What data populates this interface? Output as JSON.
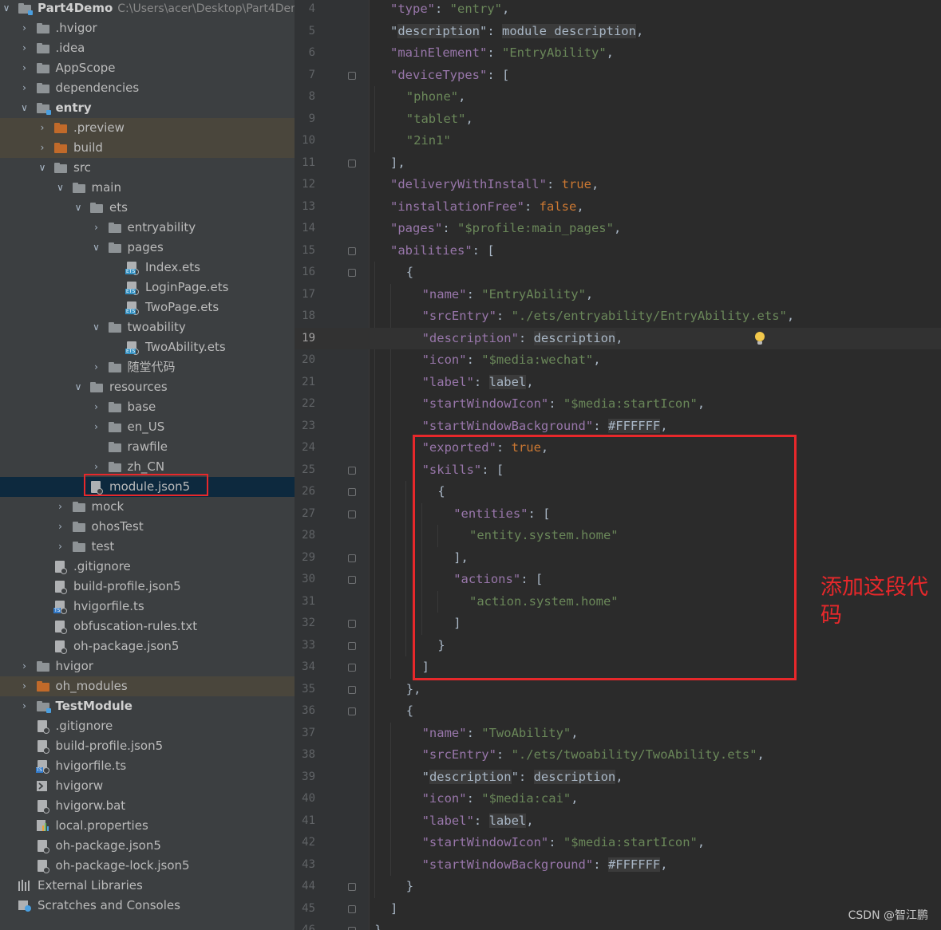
{
  "project_tree": [
    {
      "label": "Part4Demo",
      "path": "C:\\Users\\acer\\Desktop\\Part4Der",
      "level": 0,
      "arrow": "open",
      "icon": "module-folder",
      "bold": true
    },
    {
      "label": ".hvigor",
      "level": 1,
      "arrow": "closed",
      "icon": "folder"
    },
    {
      "label": ".idea",
      "level": 1,
      "arrow": "closed",
      "icon": "folder"
    },
    {
      "label": "AppScope",
      "level": 1,
      "arrow": "closed",
      "icon": "folder"
    },
    {
      "label": "dependencies",
      "level": 1,
      "arrow": "closed",
      "icon": "folder"
    },
    {
      "label": "entry",
      "level": 1,
      "arrow": "open",
      "icon": "module-folder",
      "bold": true
    },
    {
      "label": ".preview",
      "level": 2,
      "arrow": "closed",
      "icon": "folder-orange",
      "highlight": true
    },
    {
      "label": "build",
      "level": 2,
      "arrow": "closed",
      "icon": "folder-orange",
      "highlight": true
    },
    {
      "label": "src",
      "level": 2,
      "arrow": "open",
      "icon": "folder"
    },
    {
      "label": "main",
      "level": 3,
      "arrow": "open",
      "icon": "folder"
    },
    {
      "label": "ets",
      "level": 4,
      "arrow": "open",
      "icon": "folder"
    },
    {
      "label": "entryability",
      "level": 5,
      "arrow": "closed",
      "icon": "folder"
    },
    {
      "label": "pages",
      "level": 5,
      "arrow": "open",
      "icon": "folder"
    },
    {
      "label": "Index.ets",
      "level": 6,
      "arrow": "none",
      "icon": "ets-file"
    },
    {
      "label": "LoginPage.ets",
      "level": 6,
      "arrow": "none",
      "icon": "ets-file"
    },
    {
      "label": "TwoPage.ets",
      "level": 6,
      "arrow": "none",
      "icon": "ets-file"
    },
    {
      "label": "twoability",
      "level": 5,
      "arrow": "open",
      "icon": "folder"
    },
    {
      "label": "TwoAbility.ets",
      "level": 6,
      "arrow": "none",
      "icon": "ets-file"
    },
    {
      "label": "随堂代码",
      "level": 5,
      "arrow": "closed",
      "icon": "folder"
    },
    {
      "label": "resources",
      "level": 4,
      "arrow": "open",
      "icon": "folder"
    },
    {
      "label": "base",
      "level": 5,
      "arrow": "closed",
      "icon": "folder"
    },
    {
      "label": "en_US",
      "level": 5,
      "arrow": "closed",
      "icon": "folder"
    },
    {
      "label": "rawfile",
      "level": 5,
      "arrow": "none",
      "icon": "folder"
    },
    {
      "label": "zh_CN",
      "level": 5,
      "arrow": "closed",
      "icon": "folder"
    },
    {
      "label": "module.json5",
      "level": 4,
      "arrow": "none",
      "icon": "json-file",
      "selected": true
    },
    {
      "label": "mock",
      "level": 3,
      "arrow": "closed",
      "icon": "folder"
    },
    {
      "label": "ohosTest",
      "level": 3,
      "arrow": "closed",
      "icon": "folder"
    },
    {
      "label": "test",
      "level": 3,
      "arrow": "closed",
      "icon": "folder"
    },
    {
      "label": ".gitignore",
      "level": 2,
      "arrow": "none",
      "icon": "gitignore-file"
    },
    {
      "label": "build-profile.json5",
      "level": 2,
      "arrow": "none",
      "icon": "json-file"
    },
    {
      "label": "hvigorfile.ts",
      "level": 2,
      "arrow": "none",
      "icon": "ts-file"
    },
    {
      "label": "obfuscation-rules.txt",
      "level": 2,
      "arrow": "none",
      "icon": "text-file"
    },
    {
      "label": "oh-package.json5",
      "level": 2,
      "arrow": "none",
      "icon": "json-file"
    },
    {
      "label": "hvigor",
      "level": 1,
      "arrow": "closed",
      "icon": "folder"
    },
    {
      "label": "oh_modules",
      "level": 1,
      "arrow": "closed",
      "icon": "folder-orange",
      "highlight": true
    },
    {
      "label": "TestModule",
      "level": 1,
      "arrow": "closed",
      "icon": "module-folder",
      "bold": true
    },
    {
      "label": ".gitignore",
      "level": 1,
      "arrow": "none",
      "icon": "gitignore-file"
    },
    {
      "label": "build-profile.json5",
      "level": 1,
      "arrow": "none",
      "icon": "json-file"
    },
    {
      "label": "hvigorfile.ts",
      "level": 1,
      "arrow": "none",
      "icon": "ts-file"
    },
    {
      "label": "hvigorw",
      "level": 1,
      "arrow": "none",
      "icon": "shell-file"
    },
    {
      "label": "hvigorw.bat",
      "level": 1,
      "arrow": "none",
      "icon": "bat-file"
    },
    {
      "label": "local.properties",
      "level": 1,
      "arrow": "none",
      "icon": "properties-file"
    },
    {
      "label": "oh-package.json5",
      "level": 1,
      "arrow": "none",
      "icon": "json-file"
    },
    {
      "label": "oh-package-lock.json5",
      "level": 1,
      "arrow": "none",
      "icon": "json-file"
    },
    {
      "label": "External Libraries",
      "level": 0,
      "arrow": "none",
      "icon": "libraries-icon"
    },
    {
      "label": "Scratches and Consoles",
      "level": 0,
      "arrow": "none",
      "icon": "scratches-icon"
    }
  ],
  "editor": {
    "current_line": 19,
    "lines": [
      {
        "n": 4,
        "indent": 2,
        "fold": false,
        "tokens": [
          [
            "k",
            "\"type\""
          ],
          [
            "p",
            ": "
          ],
          [
            "s",
            "\"entry\""
          ],
          [
            "p",
            ","
          ]
        ]
      },
      {
        "n": 5,
        "indent": 2,
        "fold": false,
        "tokens": [
          [
            "p",
            "\""
          ],
          [
            "x",
            "description"
          ],
          [
            "p",
            "\": "
          ],
          [
            "x",
            "module description"
          ],
          [
            "p",
            ","
          ]
        ]
      },
      {
        "n": 6,
        "indent": 2,
        "fold": false,
        "tokens": [
          [
            "k",
            "\"mainElement\""
          ],
          [
            "p",
            ": "
          ],
          [
            "s",
            "\"EntryAbility\""
          ],
          [
            "p",
            ","
          ]
        ]
      },
      {
        "n": 7,
        "indent": 2,
        "fold": true,
        "tokens": [
          [
            "k",
            "\"deviceTypes\""
          ],
          [
            "p",
            ": ["
          ]
        ]
      },
      {
        "n": 8,
        "indent": 3,
        "fold": false,
        "tokens": [
          [
            "s",
            "\"phone\""
          ],
          [
            "p",
            ","
          ]
        ]
      },
      {
        "n": 9,
        "indent": 3,
        "fold": false,
        "tokens": [
          [
            "s",
            "\"tablet\""
          ],
          [
            "p",
            ","
          ]
        ]
      },
      {
        "n": 10,
        "indent": 3,
        "fold": false,
        "tokens": [
          [
            "s",
            "\"2in1\""
          ]
        ]
      },
      {
        "n": 11,
        "indent": 2,
        "fold": true,
        "tokens": [
          [
            "p",
            "],"
          ]
        ]
      },
      {
        "n": 12,
        "indent": 2,
        "fold": false,
        "tokens": [
          [
            "k",
            "\"deliveryWithInstall\""
          ],
          [
            "p",
            ": "
          ],
          [
            "b",
            "true"
          ],
          [
            "p",
            ","
          ]
        ]
      },
      {
        "n": 13,
        "indent": 2,
        "fold": false,
        "tokens": [
          [
            "k",
            "\"installationFree\""
          ],
          [
            "p",
            ": "
          ],
          [
            "b",
            "false"
          ],
          [
            "p",
            ","
          ]
        ]
      },
      {
        "n": 14,
        "indent": 2,
        "fold": false,
        "tokens": [
          [
            "k",
            "\"pages\""
          ],
          [
            "p",
            ": "
          ],
          [
            "s",
            "\"$profile:main_pages\""
          ],
          [
            "p",
            ","
          ]
        ]
      },
      {
        "n": 15,
        "indent": 2,
        "fold": true,
        "tokens": [
          [
            "k",
            "\"abilities\""
          ],
          [
            "p",
            ": ["
          ]
        ]
      },
      {
        "n": 16,
        "indent": 3,
        "fold": true,
        "tokens": [
          [
            "p",
            "{"
          ]
        ]
      },
      {
        "n": 17,
        "indent": 4,
        "fold": false,
        "tokens": [
          [
            "k",
            "\"name\""
          ],
          [
            "p",
            ": "
          ],
          [
            "s",
            "\"EntryAbility\""
          ],
          [
            "p",
            ","
          ]
        ]
      },
      {
        "n": 18,
        "indent": 4,
        "fold": false,
        "tokens": [
          [
            "k",
            "\"srcEntry\""
          ],
          [
            "p",
            ": "
          ],
          [
            "s",
            "\"./ets/entryability/EntryAbility.ets\""
          ],
          [
            "p",
            ","
          ]
        ]
      },
      {
        "n": 19,
        "indent": 4,
        "fold": false,
        "bulb": true,
        "tokens": [
          [
            "k",
            "\"description\""
          ],
          [
            "p",
            ": "
          ],
          [
            "x",
            "description"
          ],
          [
            "p",
            ","
          ]
        ]
      },
      {
        "n": 20,
        "indent": 4,
        "fold": false,
        "tokens": [
          [
            "k",
            "\"icon\""
          ],
          [
            "p",
            ": "
          ],
          [
            "s",
            "\"$media:wechat\""
          ],
          [
            "p",
            ","
          ]
        ]
      },
      {
        "n": 21,
        "indent": 4,
        "fold": false,
        "tokens": [
          [
            "k",
            "\"label\""
          ],
          [
            "p",
            ": "
          ],
          [
            "x",
            "label"
          ],
          [
            "p",
            ","
          ]
        ]
      },
      {
        "n": 22,
        "indent": 4,
        "fold": false,
        "tokens": [
          [
            "k",
            "\"startWindowIcon\""
          ],
          [
            "p",
            ": "
          ],
          [
            "s",
            "\"$media:startIcon\""
          ],
          [
            "p",
            ","
          ]
        ]
      },
      {
        "n": 23,
        "indent": 4,
        "fold": false,
        "tokens": [
          [
            "k",
            "\"startWindowBackground\""
          ],
          [
            "p",
            ": "
          ],
          [
            "x",
            "#FFFFFF"
          ],
          [
            "p",
            ","
          ]
        ]
      },
      {
        "n": 24,
        "indent": 4,
        "fold": false,
        "tokens": [
          [
            "k",
            "\"exported\""
          ],
          [
            "p",
            ": "
          ],
          [
            "b",
            "true"
          ],
          [
            "p",
            ","
          ]
        ]
      },
      {
        "n": 25,
        "indent": 4,
        "fold": true,
        "tokens": [
          [
            "k",
            "\"skills\""
          ],
          [
            "p",
            ": ["
          ]
        ]
      },
      {
        "n": 26,
        "indent": 5,
        "fold": true,
        "tokens": [
          [
            "p",
            "{"
          ]
        ]
      },
      {
        "n": 27,
        "indent": 6,
        "fold": true,
        "tokens": [
          [
            "k",
            "\"entities\""
          ],
          [
            "p",
            ": ["
          ]
        ]
      },
      {
        "n": 28,
        "indent": 7,
        "fold": false,
        "tokens": [
          [
            "s",
            "\"entity.system.home\""
          ]
        ]
      },
      {
        "n": 29,
        "indent": 6,
        "fold": true,
        "tokens": [
          [
            "p",
            "],"
          ]
        ]
      },
      {
        "n": 30,
        "indent": 6,
        "fold": true,
        "tokens": [
          [
            "k",
            "\"actions\""
          ],
          [
            "p",
            ": ["
          ]
        ]
      },
      {
        "n": 31,
        "indent": 7,
        "fold": false,
        "tokens": [
          [
            "s",
            "\"action.system.home\""
          ]
        ]
      },
      {
        "n": 32,
        "indent": 6,
        "fold": true,
        "tokens": [
          [
            "p",
            "]"
          ]
        ]
      },
      {
        "n": 33,
        "indent": 5,
        "fold": true,
        "tokens": [
          [
            "p",
            "}"
          ]
        ]
      },
      {
        "n": 34,
        "indent": 4,
        "fold": true,
        "tokens": [
          [
            "p",
            "]"
          ]
        ]
      },
      {
        "n": 35,
        "indent": 3,
        "fold": true,
        "tokens": [
          [
            "p",
            "},"
          ]
        ]
      },
      {
        "n": 36,
        "indent": 3,
        "fold": true,
        "tokens": [
          [
            "p",
            "{"
          ]
        ]
      },
      {
        "n": 37,
        "indent": 4,
        "fold": false,
        "tokens": [
          [
            "k",
            "\"name\""
          ],
          [
            "p",
            ": "
          ],
          [
            "s",
            "\"TwoAbility\""
          ],
          [
            "p",
            ","
          ]
        ]
      },
      {
        "n": 38,
        "indent": 4,
        "fold": false,
        "tokens": [
          [
            "k",
            "\"srcEntry\""
          ],
          [
            "p",
            ": "
          ],
          [
            "s",
            "\"./ets/twoability/TwoAbility.ets\""
          ],
          [
            "p",
            ","
          ]
        ]
      },
      {
        "n": 39,
        "indent": 4,
        "fold": false,
        "tokens": [
          [
            "p",
            "\""
          ],
          [
            "x",
            "description"
          ],
          [
            "p",
            "\": "
          ],
          [
            "x",
            "description"
          ],
          [
            "p",
            ","
          ]
        ]
      },
      {
        "n": 40,
        "indent": 4,
        "fold": false,
        "tokens": [
          [
            "k",
            "\"icon\""
          ],
          [
            "p",
            ": "
          ],
          [
            "s",
            "\"$media:cai\""
          ],
          [
            "p",
            ","
          ]
        ]
      },
      {
        "n": 41,
        "indent": 4,
        "fold": false,
        "tokens": [
          [
            "k",
            "\"label\""
          ],
          [
            "p",
            ": "
          ],
          [
            "x",
            "label"
          ],
          [
            "p",
            ","
          ]
        ]
      },
      {
        "n": 42,
        "indent": 4,
        "fold": false,
        "tokens": [
          [
            "k",
            "\"startWindowIcon\""
          ],
          [
            "p",
            ": "
          ],
          [
            "s",
            "\"$media:startIcon\""
          ],
          [
            "p",
            ","
          ]
        ]
      },
      {
        "n": 43,
        "indent": 4,
        "fold": false,
        "tokens": [
          [
            "k",
            "\"startWindowBackground\""
          ],
          [
            "p",
            ": "
          ],
          [
            "x",
            "#FFFFFF"
          ],
          [
            "p",
            ","
          ]
        ]
      },
      {
        "n": 44,
        "indent": 3,
        "fold": true,
        "tokens": [
          [
            "p",
            "}"
          ]
        ]
      },
      {
        "n": 45,
        "indent": 2,
        "fold": true,
        "tokens": [
          [
            "p",
            "]"
          ]
        ]
      },
      {
        "n": 46,
        "indent": 1,
        "fold": true,
        "tokens": [
          [
            "p",
            "}"
          ]
        ]
      }
    ]
  },
  "annotation": {
    "text": "添加这段代码",
    "color": "#e7282b"
  },
  "watermark": "CSDN @智江鹏",
  "colors": {
    "key": "#9876aa",
    "string": "#6a8759",
    "keyword": "#cc7832",
    "text": "#a9b7c6",
    "highlight_box": "#e7282b"
  }
}
